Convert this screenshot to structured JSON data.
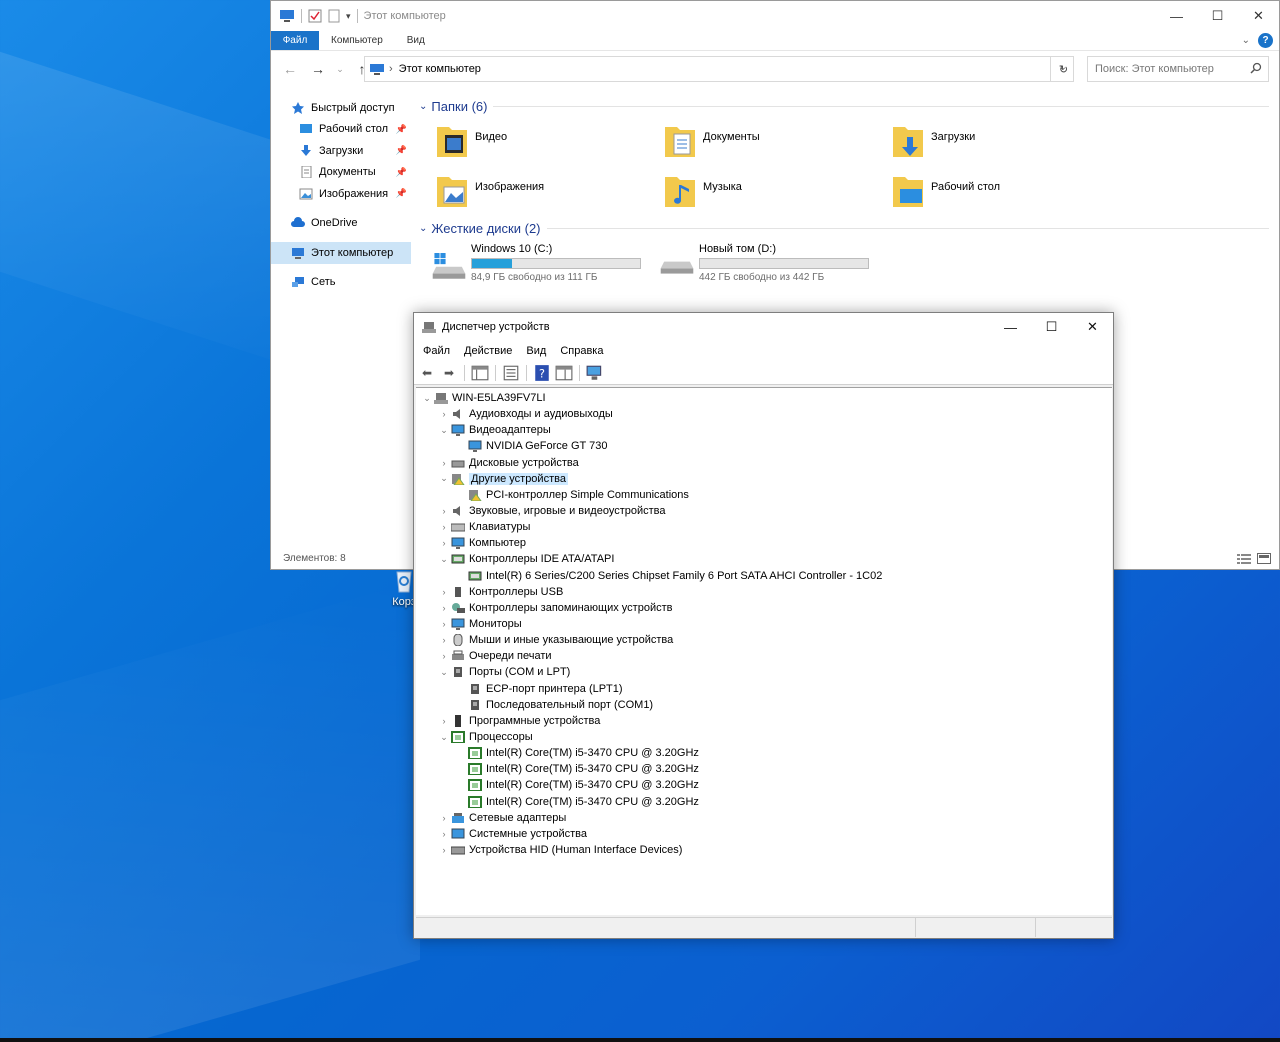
{
  "desktop": {
    "recycle_label": "Корз"
  },
  "explorer": {
    "title": "Этот компьютер",
    "ribbon_tabs": [
      "Файл",
      "Компьютер",
      "Вид"
    ],
    "breadcrumb": "Этот компьютер",
    "search_placeholder": "Поиск: Этот компьютер",
    "nav": {
      "quick_access": "Быстрый доступ",
      "quick_items": [
        "Рабочий стол",
        "Загрузки",
        "Документы",
        "Изображения"
      ],
      "onedrive": "OneDrive",
      "this_pc": "Этот компьютер",
      "network": "Сеть"
    },
    "folders_header": "Папки (6)",
    "folders": [
      "Видео",
      "Документы",
      "Загрузки",
      "Изображения",
      "Музыка",
      "Рабочий стол"
    ],
    "drives_header": "Жесткие диски (2)",
    "drives": [
      {
        "name": "Windows 10 (C:)",
        "free_text": "84,9 ГБ свободно из 111 ГБ",
        "used_fraction": 0.24
      },
      {
        "name": "Новый том (D:)",
        "free_text": "442 ГБ свободно из 442 ГБ",
        "used_fraction": 0.0
      }
    ],
    "status": "Элементов: 8"
  },
  "devmgr": {
    "title": "Диспетчер устройств",
    "menu": [
      "Файл",
      "Действие",
      "Вид",
      "Справка"
    ],
    "root": "WIN-E5LA39FV7LI",
    "tree": [
      {
        "label": "Аудиовходы и аудиовыходы",
        "expanded": false,
        "icon": "speaker-icon"
      },
      {
        "label": "Видеоадаптеры",
        "expanded": true,
        "icon": "monitor-icon",
        "children": [
          "NVIDIA GeForce GT 730"
        ]
      },
      {
        "label": "Дисковые устройства",
        "expanded": false,
        "icon": "disk-icon"
      },
      {
        "label": "Другие устройства",
        "expanded": true,
        "icon": "unknown-device-icon",
        "selected": true,
        "children": [
          "PCI-контроллер Simple Communications"
        ]
      },
      {
        "label": "Звуковые, игровые и видеоустройства",
        "expanded": false,
        "icon": "speaker-icon"
      },
      {
        "label": "Клавиатуры",
        "expanded": false,
        "icon": "keyboard-icon"
      },
      {
        "label": "Компьютер",
        "expanded": false,
        "icon": "monitor-icon"
      },
      {
        "label": "Контроллеры IDE ATA/ATAPI",
        "expanded": true,
        "icon": "controller-icon",
        "children": [
          "Intel(R) 6 Series/C200 Series Chipset Family 6 Port SATA AHCI Controller - 1C02"
        ]
      },
      {
        "label": "Контроллеры USB",
        "expanded": false,
        "icon": "usb-icon"
      },
      {
        "label": "Контроллеры запоминающих устройств",
        "expanded": false,
        "icon": "storage-icon"
      },
      {
        "label": "Мониторы",
        "expanded": false,
        "icon": "monitor-icon"
      },
      {
        "label": "Мыши и иные указывающие устройства",
        "expanded": false,
        "icon": "mouse-icon"
      },
      {
        "label": "Очереди печати",
        "expanded": false,
        "icon": "printer-icon"
      },
      {
        "label": "Порты (COM и LPT)",
        "expanded": true,
        "icon": "port-icon",
        "children": [
          "ECP-порт принтера (LPT1)",
          "Последовательный порт (COM1)"
        ]
      },
      {
        "label": "Программные устройства",
        "expanded": false,
        "icon": "software-device-icon"
      },
      {
        "label": "Процессоры",
        "expanded": true,
        "icon": "cpu-icon",
        "children": [
          "Intel(R) Core(TM) i5-3470 CPU @ 3.20GHz",
          "Intel(R) Core(TM) i5-3470 CPU @ 3.20GHz",
          "Intel(R) Core(TM) i5-3470 CPU @ 3.20GHz",
          "Intel(R) Core(TM) i5-3470 CPU @ 3.20GHz"
        ]
      },
      {
        "label": "Сетевые адаптеры",
        "expanded": false,
        "icon": "network-adapter-icon"
      },
      {
        "label": "Системные устройства",
        "expanded": false,
        "icon": "system-device-icon"
      },
      {
        "label": "Устройства HID (Human Interface Devices)",
        "expanded": false,
        "icon": "hid-icon"
      }
    ]
  },
  "colors": {
    "accent": "#1a73c9",
    "drive_bar": "#26a0da",
    "selection": "#cce8ff",
    "folder": "#f2c94c"
  }
}
